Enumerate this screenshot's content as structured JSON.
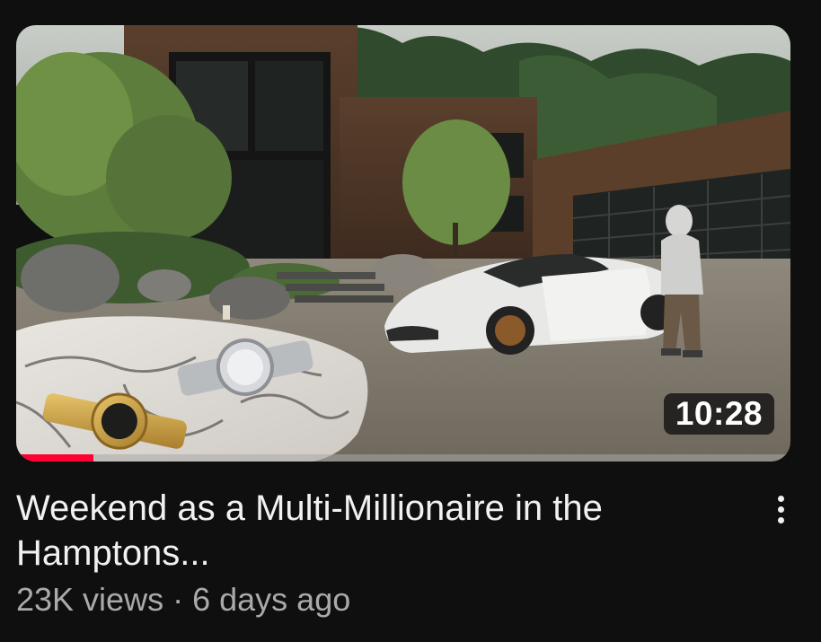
{
  "video": {
    "title": "Weekend as a Multi-Millionaire in the Hamptons...",
    "views": "23K views",
    "separator": "·",
    "age": "6 days ago",
    "duration": "10:28",
    "watch_progress": 0.1
  },
  "icons": {
    "menu": "more-vert-icon"
  },
  "colors": {
    "background": "#0f0f0f",
    "progress": "#ff0033",
    "title_text": "#f1f1f1",
    "meta_text": "#aaaaaa"
  }
}
